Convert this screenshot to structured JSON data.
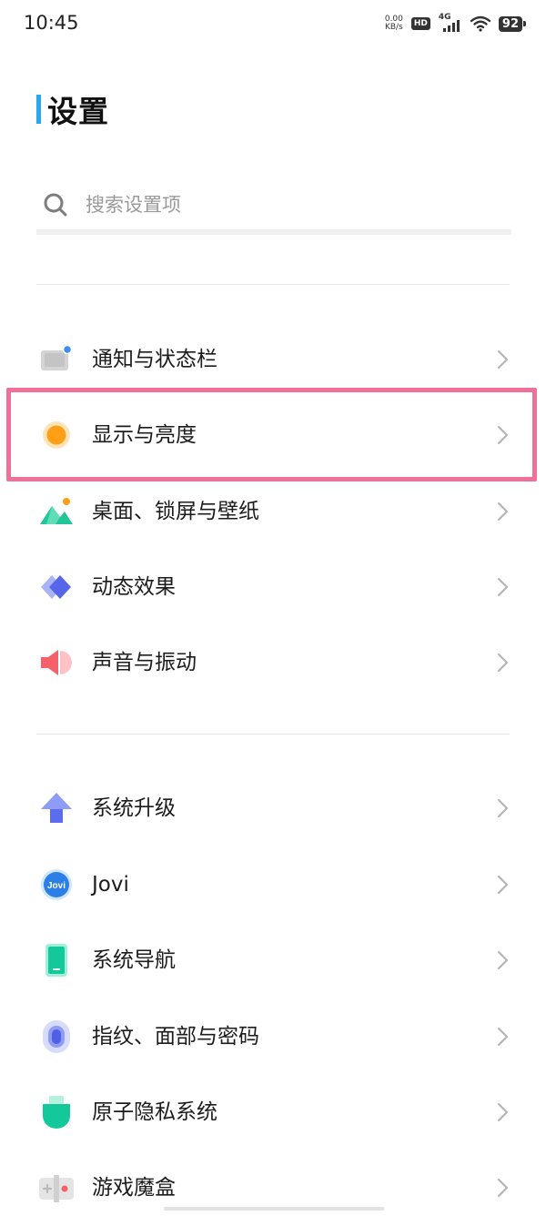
{
  "status_bar": {
    "time": "10:45",
    "net_speed_value": "0.00",
    "net_speed_unit": "KB/s",
    "hd_label": "HD",
    "network_label": "4G",
    "battery_level": "92",
    "icons": [
      "hd-icon",
      "4g-signal-icon",
      "wifi-icon",
      "battery-icon"
    ]
  },
  "page": {
    "title": "设置",
    "accent_color": "#2aa6f5"
  },
  "search": {
    "placeholder": "搜索设置项",
    "value": ""
  },
  "sections": [
    {
      "items": [
        {
          "label": "通知与状态栏",
          "icon": "notification-icon"
        },
        {
          "label": "显示与亮度",
          "icon": "display-brightness-icon",
          "highlighted": true
        },
        {
          "label": "桌面、锁屏与壁纸",
          "icon": "wallpaper-icon"
        },
        {
          "label": "动态效果",
          "icon": "motion-effects-icon"
        },
        {
          "label": "声音与振动",
          "icon": "sound-icon"
        }
      ]
    },
    {
      "items": [
        {
          "label": "系统升级",
          "icon": "system-update-icon"
        },
        {
          "label": "Jovi",
          "icon": "jovi-icon",
          "icon_text": "Jovi"
        },
        {
          "label": "系统导航",
          "icon": "system-navigation-icon"
        },
        {
          "label": "指纹、面部与密码",
          "icon": "fingerprint-icon"
        },
        {
          "label": "原子隐私系统",
          "icon": "privacy-icon"
        },
        {
          "label": "游戏魔盒",
          "icon": "game-box-icon"
        }
      ]
    }
  ],
  "highlight_color": "#f0709a"
}
